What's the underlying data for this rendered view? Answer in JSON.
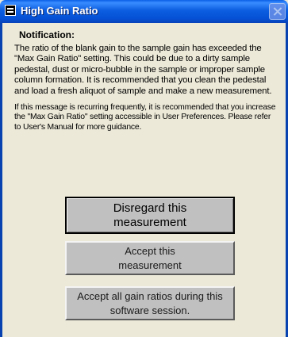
{
  "window": {
    "title": "High Gain Ratio",
    "icon": "app-icon",
    "close_icon": "close-icon"
  },
  "notification": {
    "heading": "Notification:",
    "paragraph1": "The ratio of the blank gain to the sample gain has exceeded the \"Max Gain Ratio\" setting. This could be due to a dirty sample pedestal, dust or micro-bubble in the sample or improper sample column formation. It is recommended that you clean the pedestal  and load a fresh aliquot of sample and make a new measurement.",
    "paragraph2": "If this message is recurring frequently, it is recommended that you increase the \"Max Gain Ratio\" setting accessible in User Preferences.  Please refer to User's Manual for more guidance."
  },
  "buttons": {
    "disregard": "Disregard this measurement",
    "accept": "Accept this measurement",
    "accept_all": "Accept all gain ratios during this software session."
  }
}
